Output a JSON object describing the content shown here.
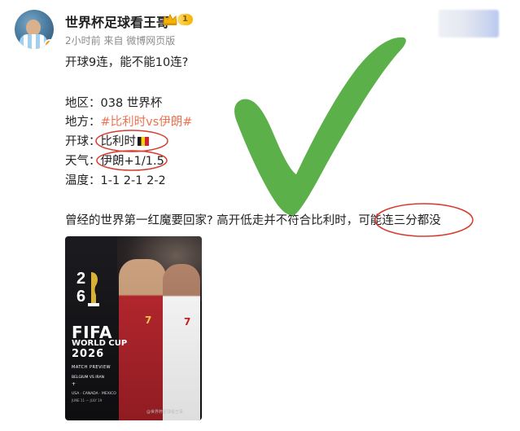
{
  "header": {
    "username": "世界杯足球看王哥",
    "level_badge": "1",
    "meta": "2小时前  来自 微博网页版"
  },
  "post": {
    "intro": "开球9连，能不能10连?",
    "region": {
      "label": "地区：",
      "value": "038 世界杯"
    },
    "teams": {
      "label": "地方：",
      "value": "#比利时vs伊朗#"
    },
    "kickoff": {
      "label": "开球：",
      "value": "比利时"
    },
    "weather": {
      "label": "天气：",
      "value": "伊朗+1/1.5"
    },
    "temperature": {
      "label": "温度：",
      "value": "1-1  2-1  2-2"
    },
    "comment_main": "曾经的世界第一红魔要回家? 高开低走并不符合比利时，",
    "comment_circled": "可能连三分都没"
  },
  "poster": {
    "fifa": "FIFA",
    "world_cup": "WORLD CUP",
    "year": "2026",
    "match_preview": "MATCH PREVIEW",
    "matchup": "BELGIUM VS IRAN",
    "plus": "+",
    "hosts": "USA · CANADA · MEXICO",
    "dates": "JUNE 11 — JULY 19",
    "player1_number": "7",
    "player2_number": "7",
    "watermark": "@世界杯足球看王哥"
  },
  "colors": {
    "topic": "#eb7350",
    "annotation_red": "#d83a2e",
    "checkmark_green": "#5cb04a",
    "verified": "#ff8a00"
  },
  "icons": [
    "avatar",
    "verified-icon",
    "crown-icon",
    "belgium-flag-icon",
    "checkmark-annotation",
    "trophy-icon"
  ]
}
